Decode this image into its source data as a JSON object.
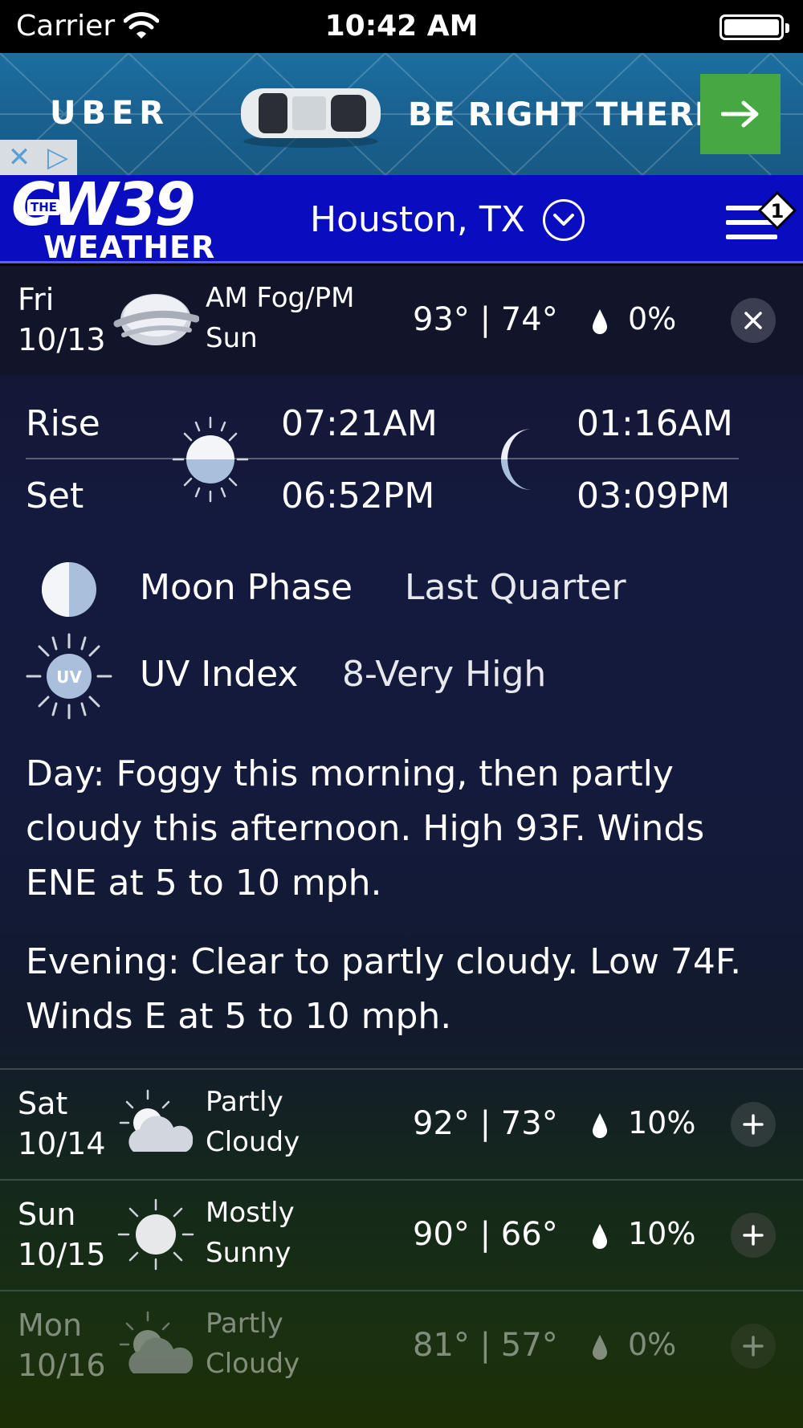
{
  "status_bar": {
    "carrier": "Carrier",
    "time": "10:42 AM"
  },
  "ad": {
    "brand": "UBER",
    "tagline": "BE RIGHT THERE",
    "cta_icon": "arrow-right-icon"
  },
  "header": {
    "location": "Houston, TX",
    "logo_the": "THE",
    "logo_cw": "CW39",
    "logo_weather": "WEATHER",
    "notification_count": "1"
  },
  "today": {
    "day": "Fri",
    "date": "10/13",
    "cond_line1": "AM Fog/PM",
    "cond_line2": "Sun",
    "temps": "93° | 74°",
    "precip": "0%",
    "icon": "fog-icon",
    "rise_label": "Rise",
    "set_label": "Set",
    "sunrise": "07:21AM",
    "sunset": "06:52PM",
    "moonrise": "01:16AM",
    "moonset": "03:09PM",
    "moon_phase_label": "Moon Phase",
    "moon_phase": "Last Quarter",
    "uv_label": "UV Index",
    "uv_value": "8-Very High",
    "uv_icon_text": "UV",
    "day_text": "Day: Foggy this morning, then partly cloudy this afternoon. High 93F. Winds ENE at 5 to 10 mph.",
    "evening_text": "Evening: Clear to partly cloudy. Low 74F. Winds E at 5 to 10 mph."
  },
  "forecast": [
    {
      "day": "Sat",
      "date": "10/14",
      "cond_line1": "Partly",
      "cond_line2": "Cloudy",
      "temps": "92° | 73°",
      "precip": "10%",
      "icon": "partly-cloudy-icon"
    },
    {
      "day": "Sun",
      "date": "10/15",
      "cond_line1": "Mostly",
      "cond_line2": "Sunny",
      "temps": "90° | 66°",
      "precip": "10%",
      "icon": "sunny-icon"
    },
    {
      "day": "Mon",
      "date": "10/16",
      "cond_line1": "Partly",
      "cond_line2": "Cloudy",
      "temps": "81° | 57°",
      "precip": "0%",
      "icon": "partly-cloudy-icon"
    }
  ]
}
